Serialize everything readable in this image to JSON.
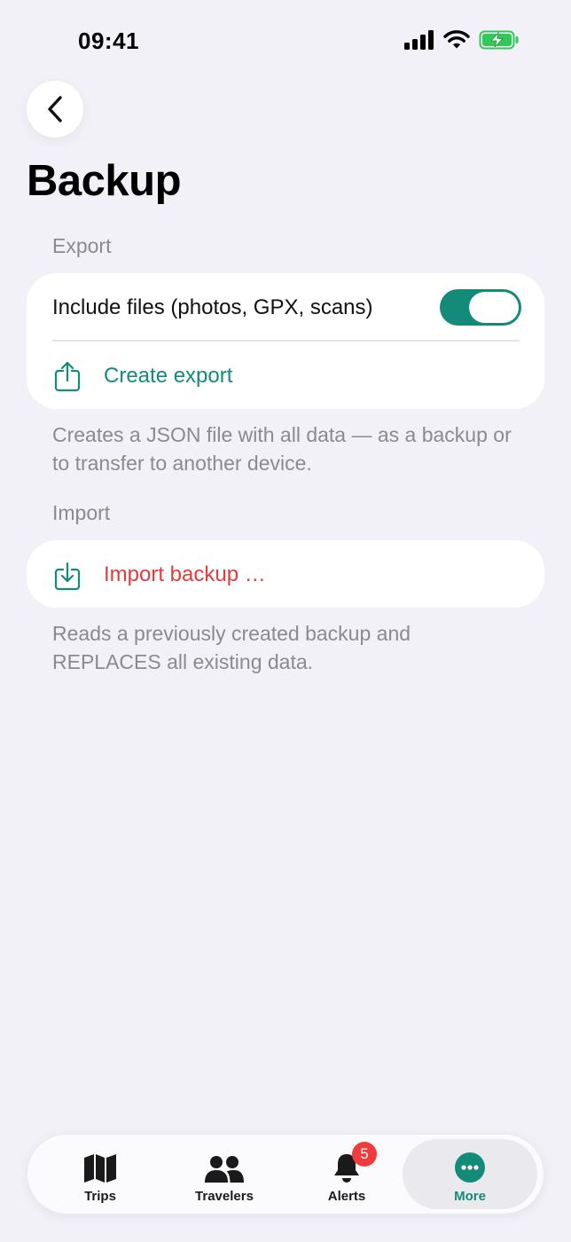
{
  "status_bar": {
    "time": "09:41"
  },
  "page": {
    "title": "Backup"
  },
  "export": {
    "section_label": "Export",
    "include_files_label": "Include files (photos, GPX, scans)",
    "include_files_enabled": true,
    "create_export_label": "Create export",
    "footnote": "Creates a JSON file with all data — as a backup or to transfer to another device."
  },
  "import": {
    "section_label": "Import",
    "import_label": "Import backup …",
    "footnote": "Reads a previously created backup and REPLACES all existing data."
  },
  "tabbar": {
    "tabs": [
      {
        "label": "Trips",
        "icon": "map-icon"
      },
      {
        "label": "Travelers",
        "icon": "people-icon"
      },
      {
        "label": "Alerts",
        "icon": "bell-icon",
        "badge": "5"
      },
      {
        "label": "More",
        "icon": "more-icon",
        "active": true
      }
    ]
  },
  "colors": {
    "accent": "#138b79",
    "destructive": "#e53a3a",
    "background": "#f2f1f7"
  }
}
